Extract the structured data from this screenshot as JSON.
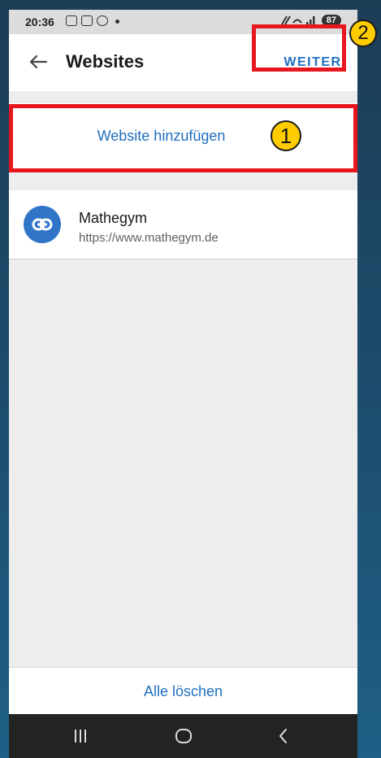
{
  "status_bar": {
    "time": "20:36",
    "battery": "87",
    "signal_text": "❀ ≂•┃"
  },
  "app_bar": {
    "title": "Websites",
    "next_label": "WEITER",
    "back_icon": "arrow-left-icon"
  },
  "add_website": {
    "label": "Website hinzufügen"
  },
  "annotations": {
    "badge_1": "1",
    "badge_2": "2",
    "highlight_color": "#e8171f",
    "badge_color": "#ffcc00"
  },
  "websites": [
    {
      "title": "Mathegym",
      "url": "https://www.mathegym.de",
      "icon": "link-icon"
    }
  ],
  "bottom": {
    "clear_all_label": "Alle löschen"
  },
  "colors": {
    "accent": "#1f6fbf",
    "avatar": "#2f74c6"
  },
  "nav_bar": {
    "recents_icon": "recents-icon",
    "home_icon": "home-icon",
    "back_icon": "back-chevron-icon"
  }
}
